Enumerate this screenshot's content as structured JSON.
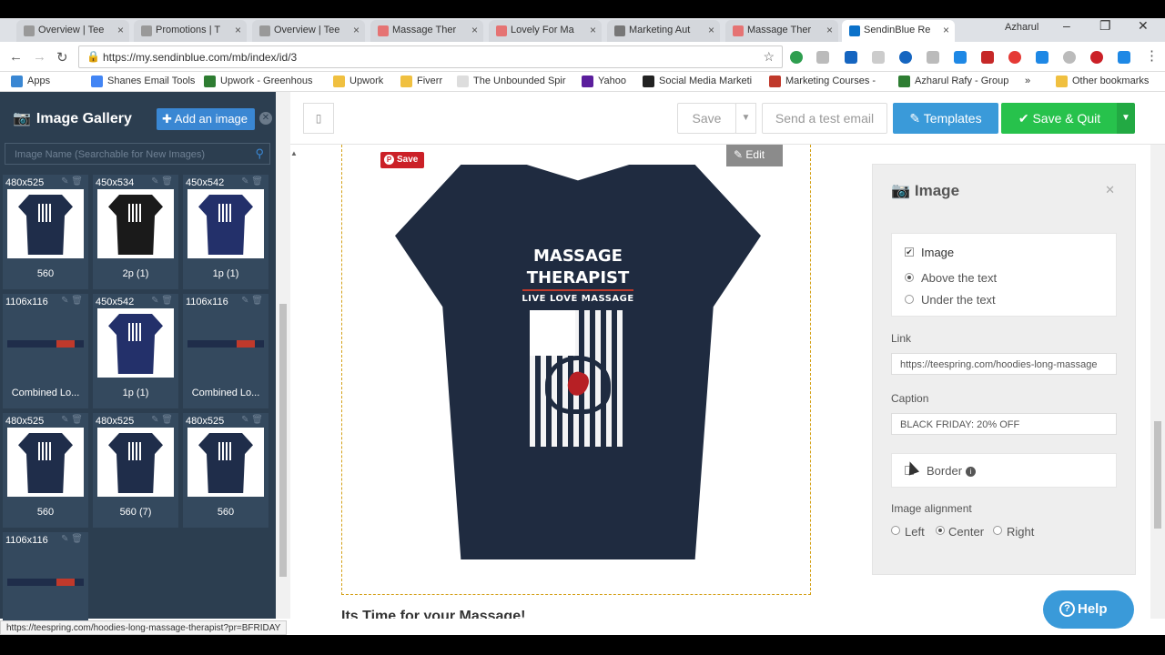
{
  "browser": {
    "tabs": [
      {
        "label": "Overview | Tee",
        "color": "#999999"
      },
      {
        "label": "Promotions | T",
        "color": "#999999"
      },
      {
        "label": "Overview | Tee",
        "color": "#999999"
      },
      {
        "label": "Massage Ther",
        "color": "#e57373"
      },
      {
        "label": "Lovely For Ma",
        "color": "#e57373"
      },
      {
        "label": "Marketing Aut",
        "color": "#777777"
      },
      {
        "label": "Massage Ther",
        "color": "#e57373"
      },
      {
        "label": "SendinBlue Re",
        "color": "#0b71c9"
      }
    ],
    "profile_name": "Azharul",
    "url": "https://my.sendinblue.com/mb/index/id/3",
    "bookmarks": [
      {
        "label": "Apps",
        "color": "#3a87d3"
      },
      {
        "label": "Shanes Email Tools",
        "color": "#4285f4"
      },
      {
        "label": "Upwork - Greenhous",
        "color": "#2e7d32"
      },
      {
        "label": "Upwork",
        "color": "#f0c040"
      },
      {
        "label": "Fiverr",
        "color": "#f0c040"
      },
      {
        "label": "The Unbounded Spir",
        "color": "#dddddd"
      },
      {
        "label": "Yahoo",
        "color": "#5b1e9c"
      },
      {
        "label": "Social Media Marketi",
        "color": "#222222"
      },
      {
        "label": "Marketing Courses -",
        "color": "#c0392b"
      },
      {
        "label": "Azharul Rafy - Group",
        "color": "#2e7d32"
      },
      {
        "label": "Other bookmarks",
        "color": "#f0c040"
      }
    ],
    "more_bookmarks": "»"
  },
  "sidebar": {
    "title": "Image Gallery",
    "add_button": "Add an image",
    "search_placeholder": "Image Name (Searchable for New Images)",
    "images": [
      {
        "dim": "480x525",
        "caption": "560",
        "kind": "tee"
      },
      {
        "dim": "450x534",
        "caption": "2p (1)",
        "kind": "blk"
      },
      {
        "dim": "450x542",
        "caption": "1p (1)",
        "kind": "navy2"
      },
      {
        "dim": "1106x116",
        "caption": "Combined Lo...",
        "kind": "banner"
      },
      {
        "dim": "450x542",
        "caption": "1p (1)",
        "kind": "navy2"
      },
      {
        "dim": "1106x116",
        "caption": "Combined Lo...",
        "kind": "banner"
      },
      {
        "dim": "480x525",
        "caption": "560",
        "kind": "tee"
      },
      {
        "dim": "480x525",
        "caption": "560 (7)",
        "kind": "tee"
      },
      {
        "dim": "480x525",
        "caption": "560",
        "kind": "tee"
      },
      {
        "dim": "1106x116",
        "caption": "",
        "kind": "banner"
      }
    ]
  },
  "toolbar": {
    "save": "Save",
    "send_test": "Send a test email",
    "templates": "Templates",
    "save_quit": "Save & Quit"
  },
  "canvas": {
    "pin_save": "Save",
    "edit": "Edit",
    "tee_line1": "MASSAGE",
    "tee_line2": "THERAPIST",
    "tee_line3": "LIVE  LOVE  MASSAGE",
    "heading": "Its Time for your Massage!"
  },
  "panel": {
    "title": "Image",
    "image_label": "Image",
    "above_text": "Above the text",
    "under_text": "Under the text",
    "link_label": "Link",
    "link_value": "https://teespring.com/hoodies-long-massage",
    "caption_label": "Caption",
    "caption_value": "BLACK FRIDAY: 20% OFF",
    "border_label": "Border",
    "alignment_label": "Image alignment",
    "align_left": "Left",
    "align_center": "Center",
    "align_right": "Right"
  },
  "help": "Help",
  "status_url": "https://teespring.com/hoodies-long-massage-therapist?pr=BFRIDAY"
}
